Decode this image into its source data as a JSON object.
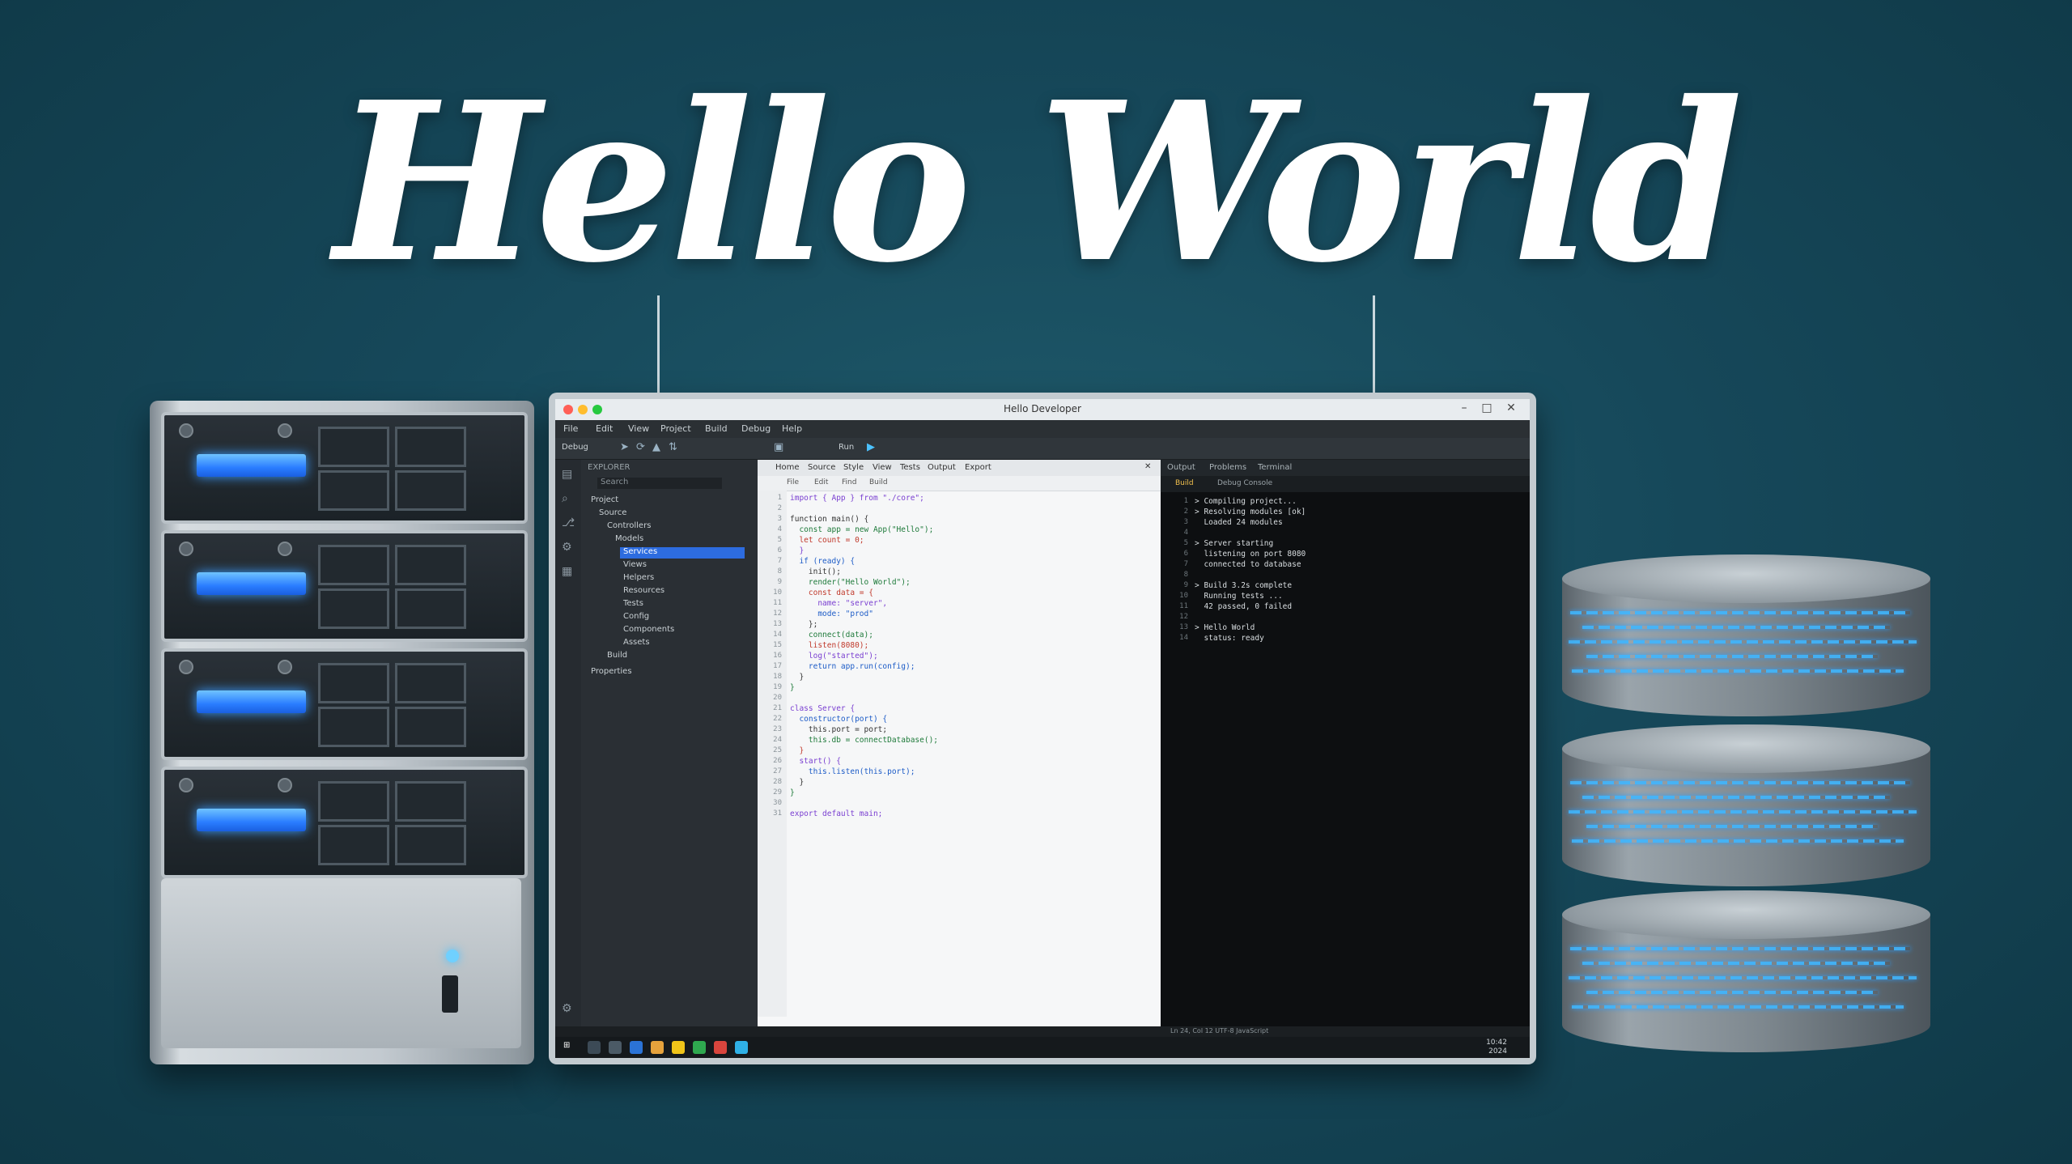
{
  "headline": "Hello World",
  "window": {
    "title": "Hello Developer",
    "menus": [
      "File",
      "Edit",
      "View",
      "Project",
      "Build",
      "Debug",
      "Help"
    ]
  },
  "toolbar": {
    "run_label": "Run",
    "target": "Debug"
  },
  "explorer": {
    "title": "EXPLORER",
    "search_placeholder": "Search",
    "items": [
      "Project",
      "Source",
      "Controllers",
      "Models",
      "Services",
      "Views",
      "Helpers",
      "Resources",
      "Tests",
      "Config",
      "Components",
      "Assets",
      "Build",
      "Properties"
    ]
  },
  "editor": {
    "tabs": [
      "Home",
      "Source",
      "Style",
      "View",
      "Tests",
      "Output",
      "Export"
    ],
    "tools": [
      "File",
      "Edit",
      "Find",
      "Build"
    ],
    "code": [
      "import { App } from \"./core\";",
      "",
      "function main() {",
      "  const app = new App(\"Hello\");",
      "  let count = 0;",
      "  }",
      "  if (ready) {",
      "    init();",
      "    render(\"Hello World\");",
      "    const data = {",
      "      name: \"server\",",
      "      mode: \"prod\"",
      "    };",
      "    connect(data);",
      "    listen(8080);",
      "    log(\"started\");",
      "    return app.run(config);",
      "  }",
      "}",
      "",
      "class Server {",
      "  constructor(port) {",
      "    this.port = port;",
      "    this.db = connectDatabase();",
      "  }",
      "  start() {",
      "    this.listen(this.port);",
      "  }",
      "}",
      "",
      "export default main;"
    ]
  },
  "terminal": {
    "tabs": [
      "Output",
      "Problems",
      "Terminal"
    ],
    "bar": [
      "Build",
      "Debug Console"
    ],
    "lines": [
      "> Compiling project...",
      "> Resolving modules [ok]",
      "  Loaded 24 modules",
      "",
      "> Server starting",
      "  listening on port 8080",
      "  connected to database",
      "",
      "> Build 3.2s complete",
      "  Running tests ...",
      "  42 passed, 0 failed",
      "",
      "> Hello World",
      "  status: ready"
    ]
  },
  "statusbar": "Ln 24, Col 12  UTF-8  JavaScript",
  "taskbar": {
    "time": "10:42",
    "date": "2024"
  },
  "colors": {
    "background": "#16485a",
    "accent_blue": "#2a8dff",
    "led_blue": "#3b9cff"
  }
}
